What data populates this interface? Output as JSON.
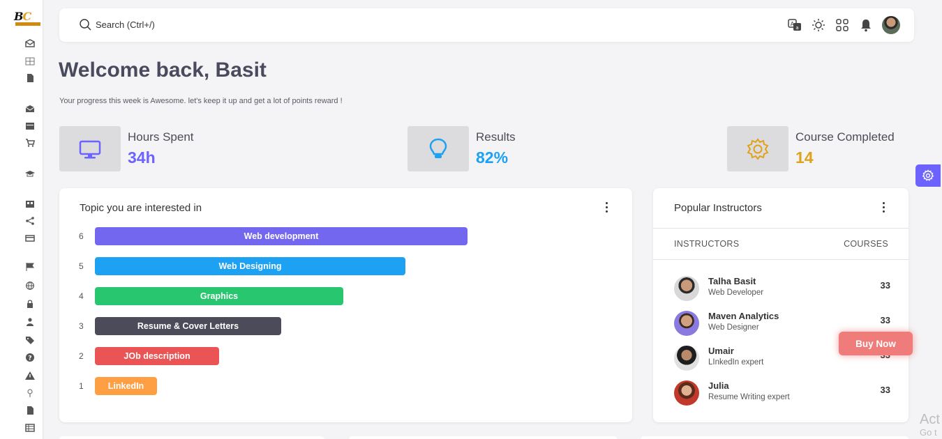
{
  "search": {
    "label": "Search (Ctrl+/)"
  },
  "welcome": {
    "title": "Welcome back, Basit",
    "subtitle": "Your progress this week is Awesome. let's keep it up and get a lot of points reward !"
  },
  "stats": [
    {
      "label": "Hours Spent",
      "value": "34h",
      "icon": "monitor-icon",
      "color": "#6c63ff"
    },
    {
      "label": "Results",
      "value": "82%",
      "icon": "lightbulb-icon",
      "color": "#1da1f2"
    },
    {
      "label": "Course Completed",
      "value": "14",
      "icon": "gear-icon",
      "color": "#e0a21a"
    }
  ],
  "topics": {
    "title": "Topic you are interested in",
    "bars": [
      {
        "num": "6",
        "label": "Web development",
        "color": "#7367f0",
        "value": 6
      },
      {
        "num": "5",
        "label": "Web Designing",
        "color": "#1da1f2",
        "value": 5
      },
      {
        "num": "4",
        "label": "Graphics",
        "color": "#28c76f",
        "value": 4
      },
      {
        "num": "3",
        "label": "Resume & Cover Letters",
        "color": "#4b4b5a",
        "value": 3
      },
      {
        "num": "2",
        "label": "JOb description",
        "color": "#ea5455",
        "value": 2
      },
      {
        "num": "1",
        "label": "LinkedIn",
        "color": "#ff9f43",
        "value": 1
      }
    ]
  },
  "instructors": {
    "title": "Popular Instructors",
    "col_instructors": "INSTRUCTORS",
    "col_courses": "COURSES",
    "rows": [
      {
        "name": "Talha Basit",
        "role": "Web Developer",
        "courses": "33"
      },
      {
        "name": "Maven Analytics",
        "role": "Web Designer",
        "courses": "33"
      },
      {
        "name": "Umair",
        "role": "LInkedIn expert",
        "courses": "33"
      },
      {
        "name": "Julia",
        "role": "Resume Writing expert",
        "courses": "33"
      }
    ]
  },
  "buy_now": "Buy Now",
  "watermark": {
    "line1": "Act",
    "line2": "Go t"
  },
  "logo": {
    "text1": "B",
    "text2": "C"
  }
}
